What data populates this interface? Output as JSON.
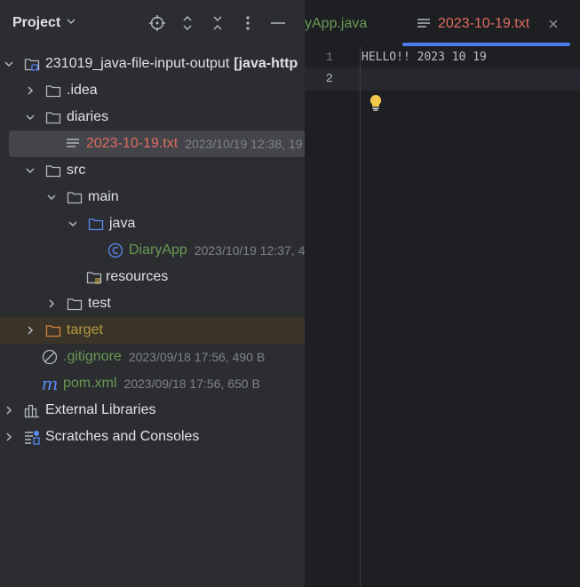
{
  "project_panel": {
    "title": "Project",
    "tree": [
      {
        "label": "231019_java-file-input-output",
        "suffix": "[java-http",
        "meta": "",
        "icon": "module-folder-icon"
      },
      {
        "label": ".idea",
        "meta": "",
        "icon": "folder-icon"
      },
      {
        "label": "diaries",
        "meta": "",
        "icon": "folder-icon"
      },
      {
        "label": "2023-10-19.txt",
        "meta": "2023/10/19 12:38, 19",
        "icon": "text-file-icon"
      },
      {
        "label": "src",
        "meta": "",
        "icon": "folder-icon"
      },
      {
        "label": "main",
        "meta": "",
        "icon": "folder-icon"
      },
      {
        "label": "java",
        "meta": "",
        "icon": "source-folder-icon"
      },
      {
        "label": "DiaryApp",
        "meta": "2023/10/19 12:37, 4",
        "icon": "java-class-icon"
      },
      {
        "label": "resources",
        "meta": "",
        "icon": "resources-folder-icon"
      },
      {
        "label": "test",
        "meta": "",
        "icon": "folder-icon"
      },
      {
        "label": "target",
        "meta": "",
        "icon": "excluded-folder-icon"
      },
      {
        "label": ".gitignore",
        "meta": "2023/09/18 17:56, 490 B",
        "icon": "ignore-file-icon"
      },
      {
        "label": "pom.xml",
        "meta": "2023/09/18 17:56, 650 B",
        "icon": "maven-icon"
      },
      {
        "label": "External Libraries",
        "meta": "",
        "icon": "libraries-icon"
      },
      {
        "label": "Scratches and Consoles",
        "meta": "",
        "icon": "scratches-icon"
      }
    ]
  },
  "editor": {
    "tabs": [
      {
        "label": "yApp.java"
      },
      {
        "label": "2023-10-19.txt"
      }
    ],
    "lines": [
      {
        "num": "1",
        "text": "HELLO!! 2023 10 19"
      },
      {
        "num": "2",
        "text": ""
      }
    ]
  },
  "colors": {
    "accent": "#4e7cf0",
    "modified_file": "#e06c5f",
    "java_class": "#6a9955",
    "excluded": "#b59a3f"
  }
}
